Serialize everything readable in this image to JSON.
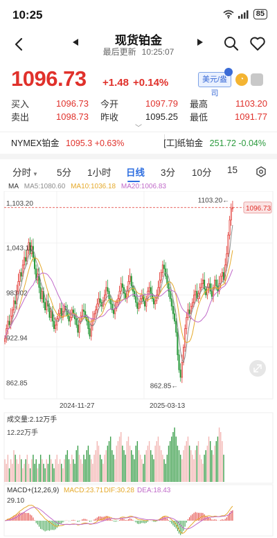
{
  "status": {
    "time": "10:25",
    "battery": "85"
  },
  "nav": {
    "title": "现货铂金",
    "updated_label": "最后更新",
    "updated_time": "10:25:07",
    "icons": [
      "back-arrow-icon",
      "prev-triangle-icon",
      "next-triangle-icon",
      "search-icon",
      "heart-icon"
    ]
  },
  "quote": {
    "price": "1096.73",
    "change": "+1.48",
    "change_pct": "+0.14%",
    "unit": "美元/盎司",
    "rows": [
      [
        {
          "l": "买入",
          "v": "1096.73",
          "c": "red"
        },
        {
          "l": "今开",
          "v": "1097.79",
          "c": "red"
        },
        {
          "l": "最高",
          "v": "1103.20",
          "c": "red"
        }
      ],
      [
        {
          "l": "卖出",
          "v": "1098.73",
          "c": "red"
        },
        {
          "l": "昨收",
          "v": "1095.25",
          "c": "dark"
        },
        {
          "l": "最低",
          "v": "1091.77",
          "c": "red"
        }
      ]
    ]
  },
  "related": {
    "left_name": "NYMEX铂金",
    "left_value": "1095.3",
    "left_pct": "+0.63%",
    "right_name": "[工]纸铂金",
    "right_value": "251.72",
    "right_pct": "-0.04%"
  },
  "tabs": [
    "分时",
    "5分",
    "1小时",
    "日线",
    "3分",
    "10分",
    "15"
  ],
  "active_tab": "日线",
  "ma": {
    "label": "MA",
    "ma5": "MA5:1080.60",
    "ma10": "MA10:1036.18",
    "ma20": "MA20:1006.83"
  },
  "colors": {
    "up": "#e0312b",
    "down": "#2a9a3c",
    "ma5": "#8c8c8c",
    "ma10": "#e5a92a",
    "ma20": "#c06ac9",
    "accent": "#2f6fe0"
  },
  "chart_data": {
    "type": "candlestick",
    "y_ticks": [
      "1,103.20",
      "1,043.11",
      "983.02",
      "922.94",
      "862.85"
    ],
    "y_tick_values": [
      1103.2,
      1043.11,
      983.02,
      922.94,
      862.85
    ],
    "ylim": [
      845,
      1115
    ],
    "x_ticks": [
      "2024-11-27",
      "2025-03-13"
    ],
    "high_marker": "1103.20",
    "low_marker": "862.85",
    "last_price_tag": "1096.73",
    "closes": [
      922,
      935,
      945,
      940,
      952,
      960,
      972,
      968,
      985,
      998,
      1010,
      1005,
      1020,
      1030,
      1025,
      1040,
      1050,
      1035,
      1045,
      1030,
      1015,
      1000,
      1008,
      990,
      975,
      985,
      970,
      960,
      972,
      965,
      950,
      958,
      945,
      935,
      940,
      948,
      955,
      962,
      950,
      958,
      965,
      960,
      952,
      945,
      950,
      960,
      955,
      948,
      940,
      930,
      945,
      952,
      960,
      958,
      950,
      945,
      935,
      925,
      940,
      948,
      955,
      960,
      968,
      975,
      970,
      965,
      972,
      980,
      990,
      985,
      975,
      968,
      960,
      955,
      962,
      970,
      975,
      985,
      995,
      990,
      982,
      975,
      985,
      998,
      1005,
      992,
      985,
      978,
      970,
      962,
      968,
      975,
      980,
      972,
      965,
      975,
      985,
      990,
      982,
      975,
      968,
      972,
      980,
      990,
      1000,
      1010,
      1020,
      1015,
      1005,
      995,
      985,
      975,
      965,
      955,
      945,
      930,
      900,
      880,
      870,
      890,
      910,
      935,
      950,
      960,
      955,
      965,
      970,
      980,
      985,
      975,
      982,
      990,
      995,
      1000,
      988,
      980,
      990,
      995,
      985,
      978,
      990,
      1000,
      992,
      985,
      995,
      1005,
      1010,
      1000,
      1020,
      1035,
      1060,
      1080,
      1095,
      1097
    ],
    "volume_label": "成交量:2.12万手",
    "volume_tick": "12.22万手",
    "volumes": [
      5,
      4,
      6,
      3,
      5,
      4,
      7,
      6,
      5,
      4,
      6,
      5,
      3,
      4,
      5,
      6,
      4,
      3,
      5,
      6,
      4,
      5,
      3,
      4,
      6,
      5,
      4,
      3,
      5,
      4,
      6,
      5,
      4,
      3,
      5,
      6,
      4,
      5,
      4,
      3,
      5,
      6,
      7,
      5,
      4,
      6,
      5,
      4,
      7,
      8,
      6,
      5,
      4,
      6,
      5,
      7,
      8,
      6,
      5,
      4,
      6,
      7,
      9,
      8,
      6,
      5,
      4,
      6,
      7,
      8,
      9,
      10,
      7,
      6,
      5,
      8,
      9,
      10,
      11,
      8,
      7,
      6,
      9,
      10,
      8,
      7,
      6,
      5,
      8,
      9,
      7,
      6,
      5,
      4,
      6,
      7,
      8,
      9,
      7,
      6,
      5,
      8,
      9,
      10,
      8,
      7,
      6,
      5,
      4,
      6,
      8,
      9,
      10,
      11,
      12,
      10,
      8,
      7,
      6,
      5,
      7,
      8,
      9,
      10,
      8,
      7,
      6,
      5,
      7,
      8,
      9,
      6,
      5,
      4,
      6,
      7,
      8,
      10,
      9,
      7,
      6,
      8,
      9,
      10,
      12,
      11,
      9,
      6
    ],
    "macd_label": "MACD+(12,26,9)",
    "macd": "MACD:23.71",
    "dif": "DIF:30.28",
    "dea": "DEA:18.43",
    "macd_tick": "29.10"
  }
}
